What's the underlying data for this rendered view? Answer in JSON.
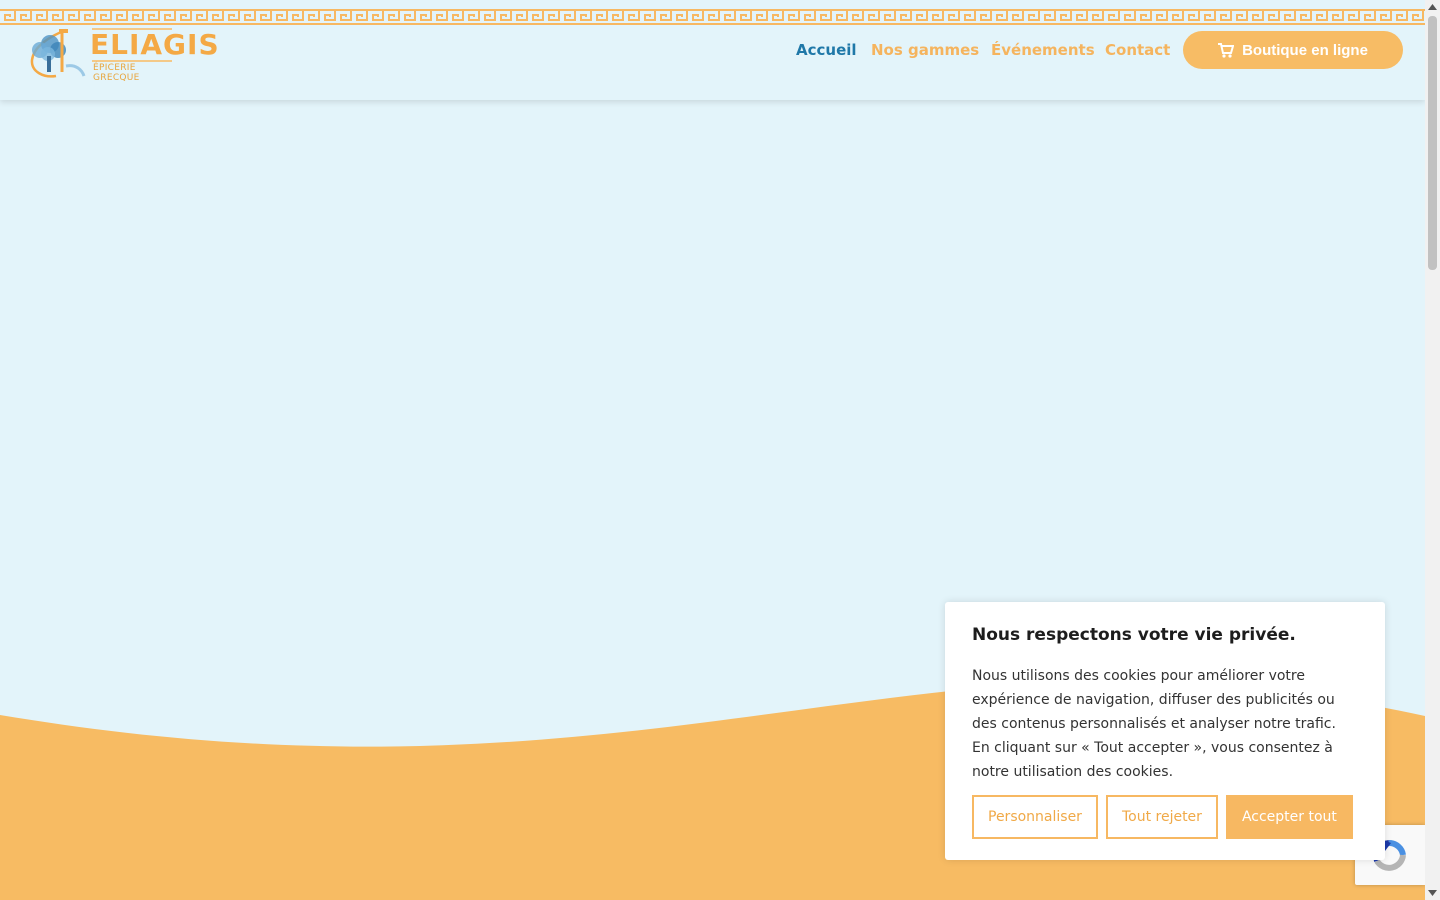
{
  "brand": {
    "name": "ELIAGIS",
    "tagline": "ÉPICERIE GRECQUE",
    "logo_icon": "olive-tree-icon"
  },
  "nav": {
    "items": [
      {
        "label": "Accueil",
        "active": true
      },
      {
        "label": "Nos gammes",
        "active": false
      },
      {
        "label": "Événements",
        "active": false
      },
      {
        "label": "Contact",
        "active": false
      }
    ],
    "shop": {
      "label": "Boutique en ligne",
      "icon": "cart-icon"
    }
  },
  "cookie": {
    "title": "Nous respectons votre vie privée.",
    "text": "Nous utilisons des cookies pour améliorer votre expérience de navigation, diffuser des publicités ou des contenus personnalisés et analyser notre trafic. En cliquant sur « Tout accepter », vous consentez à notre utilisation des cookies.",
    "buttons": {
      "customize": "Personnaliser",
      "reject": "Tout rejeter",
      "accept": "Accepter tout"
    }
  },
  "colors": {
    "accent": "#f7b862",
    "active_nav": "#1f78a8",
    "background": "#e3f4fa"
  }
}
